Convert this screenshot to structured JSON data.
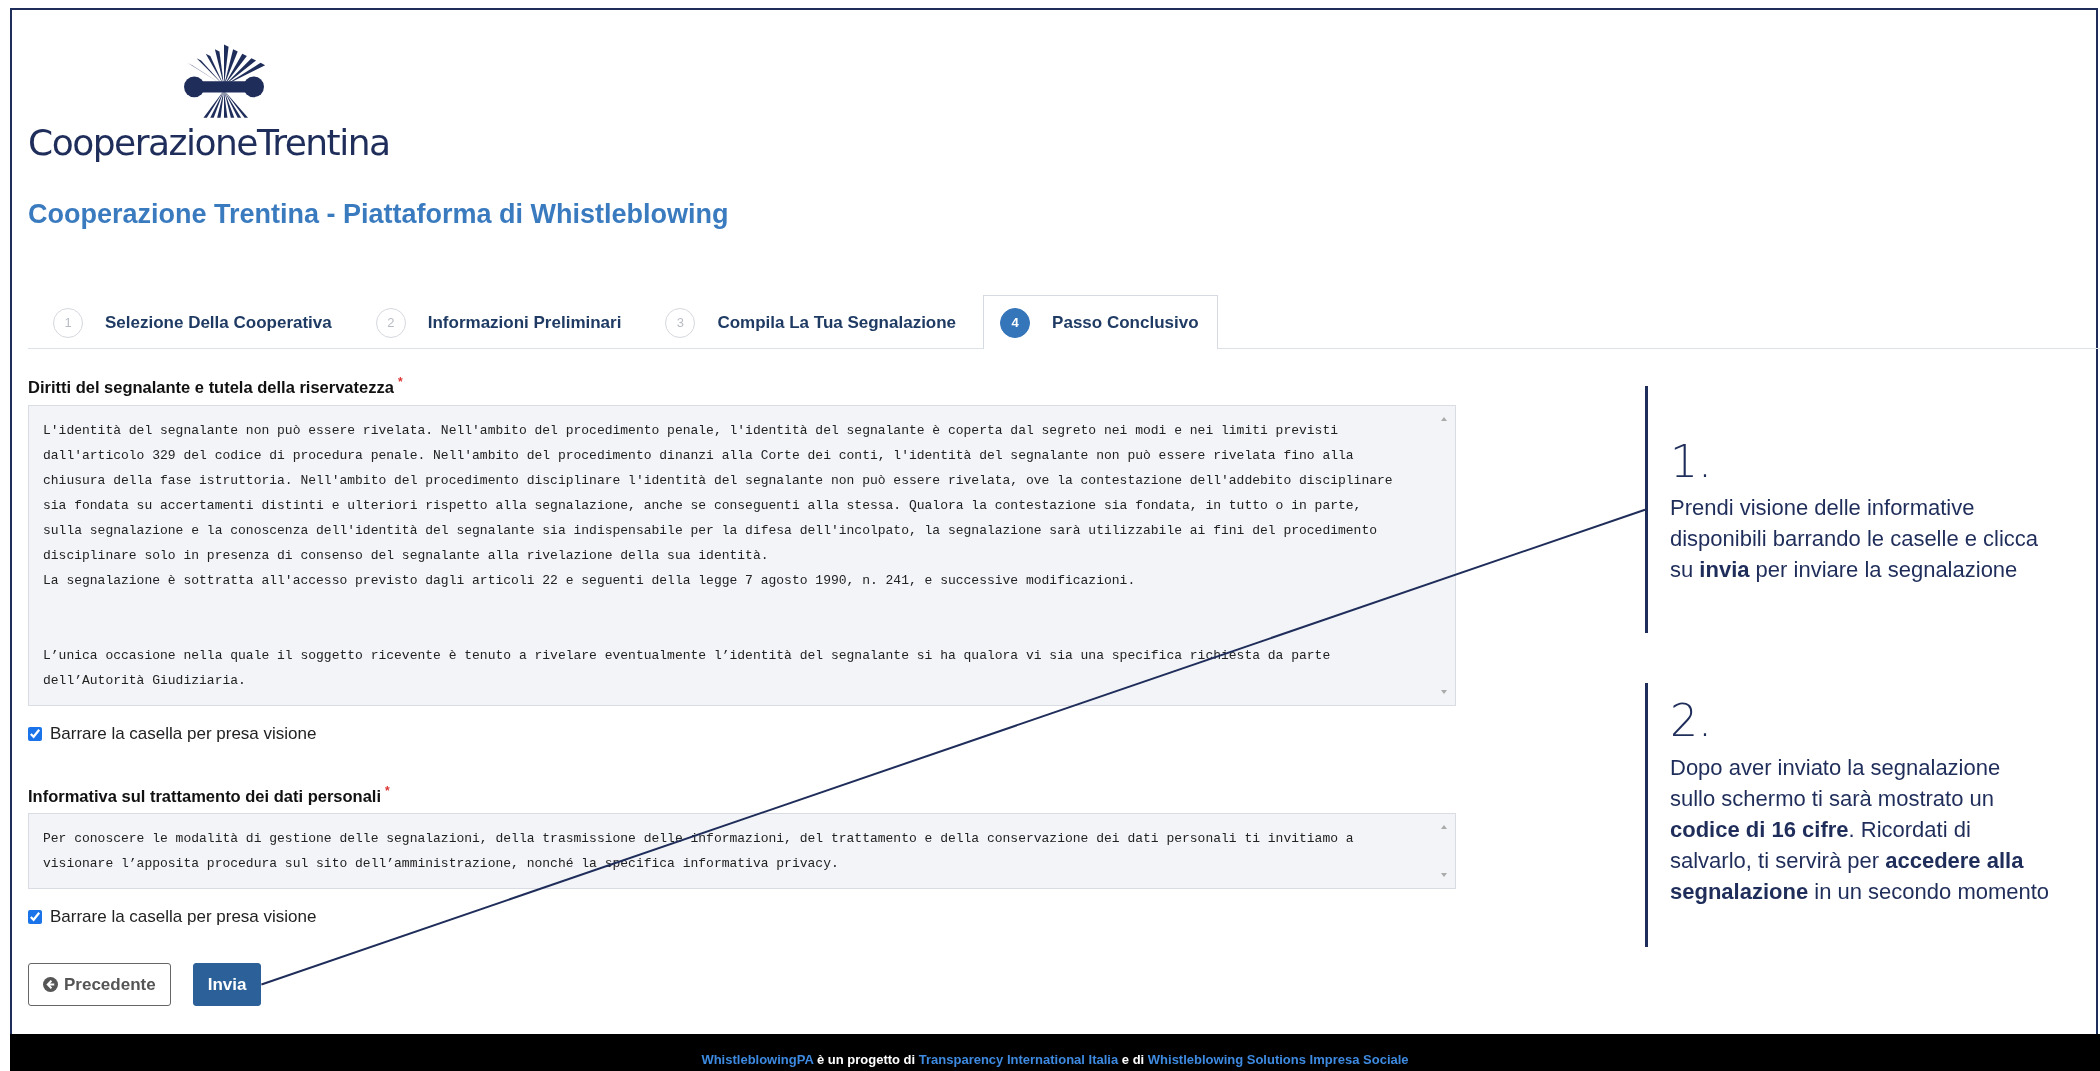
{
  "logo": {
    "text": "CooperazioneTrentina"
  },
  "page_title": "Cooperazione Trentina - Piattaforma di Whistleblowing",
  "steps": [
    {
      "number": "1",
      "label": "Selezione Della Cooperativa",
      "selected": false
    },
    {
      "number": "2",
      "label": "Informazioni Preliminari",
      "selected": false
    },
    {
      "number": "3",
      "label": "Compila La Tua Segnalazione",
      "selected": false
    },
    {
      "number": "4",
      "label": "Passo Conclusivo",
      "selected": true
    }
  ],
  "sections": [
    {
      "heading": "Diritti del segnalante e tutela della riservatezza",
      "required_mark": "*",
      "text": "L'identità del segnalante non può essere rivelata. Nell'ambito del procedimento penale, l'identità del segnalante è coperta dal segreto nei modi e nei limiti previsti dall'articolo 329 del codice di procedura penale. Nell'ambito del procedimento dinanzi alla Corte dei conti, l'identità del segnalante non può essere rivelata fino alla chiusura della fase istruttoria. Nell'ambito del procedimento disciplinare l'identità del segnalante non può essere rivelata, ove la contestazione dell'addebito disciplinare sia fondata su accertamenti distinti e ulteriori rispetto alla segnalazione, anche se conseguenti alla stessa. Qualora la contestazione sia fondata, in tutto o in parte, sulla segnalazione e la conoscenza dell'identità del segnalante sia indispensabile per la difesa dell'incolpato, la segnalazione sarà utilizzabile ai fini del procedimento disciplinare solo in presenza di consenso del segnalante alla rivelazione della sua identità.\nLa segnalazione è sottratta all'accesso previsto dagli articoli 22 e seguenti della legge 7 agosto 1990, n. 241, e successive modificazioni.\n\n\nL’unica occasione nella quale il soggetto ricevente è tenuto a rivelare eventualmente l’identità del segnalante si ha qualora vi sia una specifica richiesta da parte dell’Autorità Giudiziaria.",
      "checkbox": {
        "label": "Barrare la casella per presa visione",
        "checked": true
      }
    },
    {
      "heading": "Informativa sul trattamento dei dati personali",
      "required_mark": "*",
      "text": "Per conoscere le modalità di gestione delle segnalazioni, della trasmissione delle informazioni, del trattamento e della conservazione dei dati personali ti invitiamo a visionare l’apposita procedura sul sito dell’amministrazione, nonché la specifica informativa privacy.",
      "checkbox": {
        "label": "Barrare la casella per presa visione",
        "checked": true
      }
    }
  ],
  "buttons": [
    {
      "kind": "back",
      "label": "Precedente"
    },
    {
      "kind": "submit",
      "label": "Invia"
    }
  ],
  "instructions": [
    {
      "number": "1.",
      "text": "Prendi visione delle informative disponibili barrando le caselle e clicca su **invia** per inviare la segnalazione"
    },
    {
      "number": "2.",
      "text": "Dopo aver inviato la segnalazione sullo schermo ti sarà mostrato un **codice di 16 cifre**. Ricordati di salvarlo, ti servirà per **accedere alla segnalazione** in un secondo momento"
    }
  ],
  "footer": [
    {
      "text": "WhistleblowingPA",
      "link": true
    },
    {
      "text": " è un progetto di ",
      "link": false
    },
    {
      "text": "Transparency International Italia",
      "link": true
    },
    {
      "text": " e di ",
      "link": false
    },
    {
      "text": "Whistleblowing Solutions Impresa Sociale",
      "link": true
    }
  ]
}
